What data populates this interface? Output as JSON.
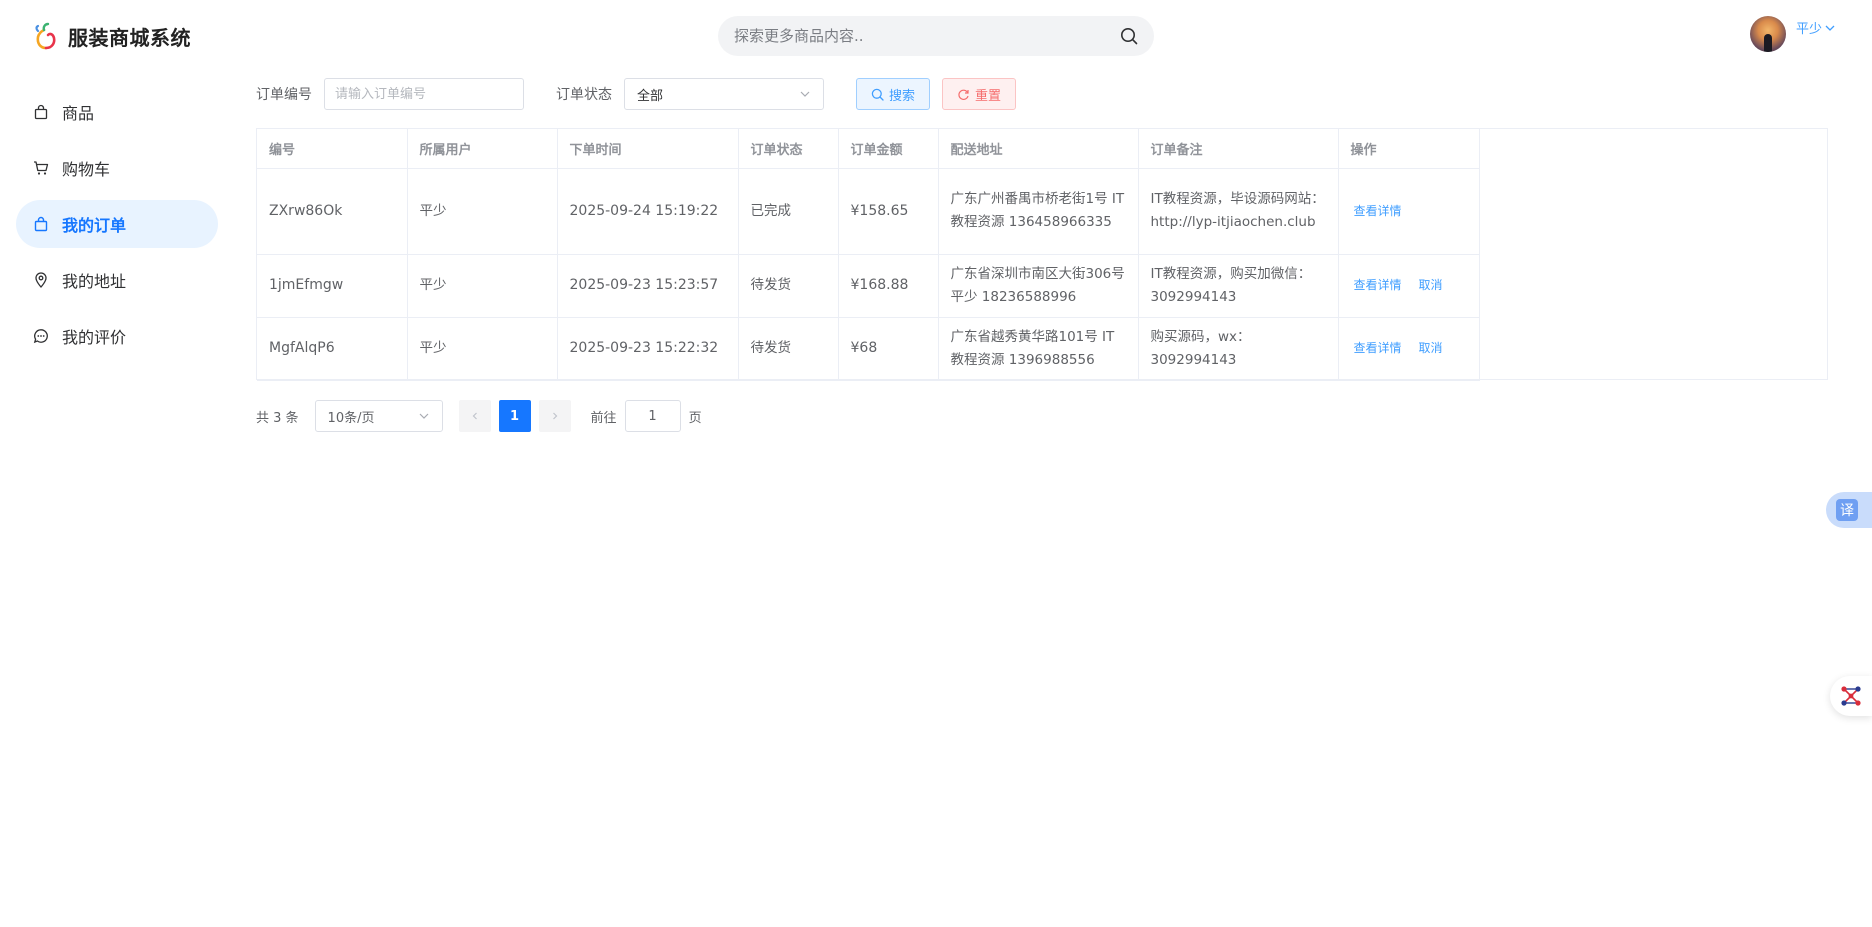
{
  "app": {
    "title": "服装商城系统"
  },
  "search": {
    "placeholder": "探索更多商品内容.."
  },
  "user": {
    "name": "平少"
  },
  "sidebar": {
    "items": [
      {
        "label": "商品",
        "icon": "shopping-bag-icon",
        "active": false
      },
      {
        "label": "购物车",
        "icon": "cart-icon",
        "active": false
      },
      {
        "label": "我的订单",
        "icon": "order-bag-icon",
        "active": true
      },
      {
        "label": "我的地址",
        "icon": "location-pin-icon",
        "active": false
      },
      {
        "label": "我的评价",
        "icon": "comment-icon",
        "active": false
      }
    ]
  },
  "filters": {
    "order_no_label": "订单编号",
    "order_no_placeholder": "请输入订单编号",
    "status_label": "订单状态",
    "status_value": "全部",
    "search_button": "搜索",
    "reset_button": "重置"
  },
  "table": {
    "headers": [
      "编号",
      "所属用户",
      "下单时间",
      "订单状态",
      "订单金额",
      "配送地址",
      "订单备注",
      "操作"
    ],
    "rows": [
      {
        "id": "ZXrw86Ok",
        "user": "平少",
        "time": "2025-09-24 15:19:22",
        "status": "已完成",
        "amount": "¥158.65",
        "address": "广东广州番禺市桥老街1号 IT教程资源 136458966335",
        "note": "IT教程资源，毕设源码网站：http://lyp-itjiaochen.club",
        "actions": [
          "查看详情"
        ]
      },
      {
        "id": "1jmEfmgw",
        "user": "平少",
        "time": "2025-09-23 15:23:57",
        "status": "待发货",
        "amount": "¥168.88",
        "address": "广东省深圳市南区大街306号 平少 18236588996",
        "note": "IT教程资源，购买加微信：3092994143",
        "actions": [
          "查看详情",
          "取消"
        ]
      },
      {
        "id": "MgfAlqP6",
        "user": "平少",
        "time": "2025-09-23 15:22:32",
        "status": "待发货",
        "amount": "¥68",
        "address": "广东省越秀黄华路101号 IT教程资源 1396988556",
        "note": "购买源码，wx：3092994143",
        "actions": [
          "查看详情",
          "取消"
        ]
      }
    ]
  },
  "pagination": {
    "total_text": "共 3 条",
    "page_size": "10条/页",
    "current_page": "1",
    "goto_label": "前往",
    "goto_value": "1",
    "page_unit": "页"
  },
  "widgets": {
    "translate_label": "译"
  },
  "colors": {
    "primary": "#1677ff",
    "link": "#409eff",
    "danger": "#f56c6c",
    "active_bg": "#e8f3ff"
  }
}
